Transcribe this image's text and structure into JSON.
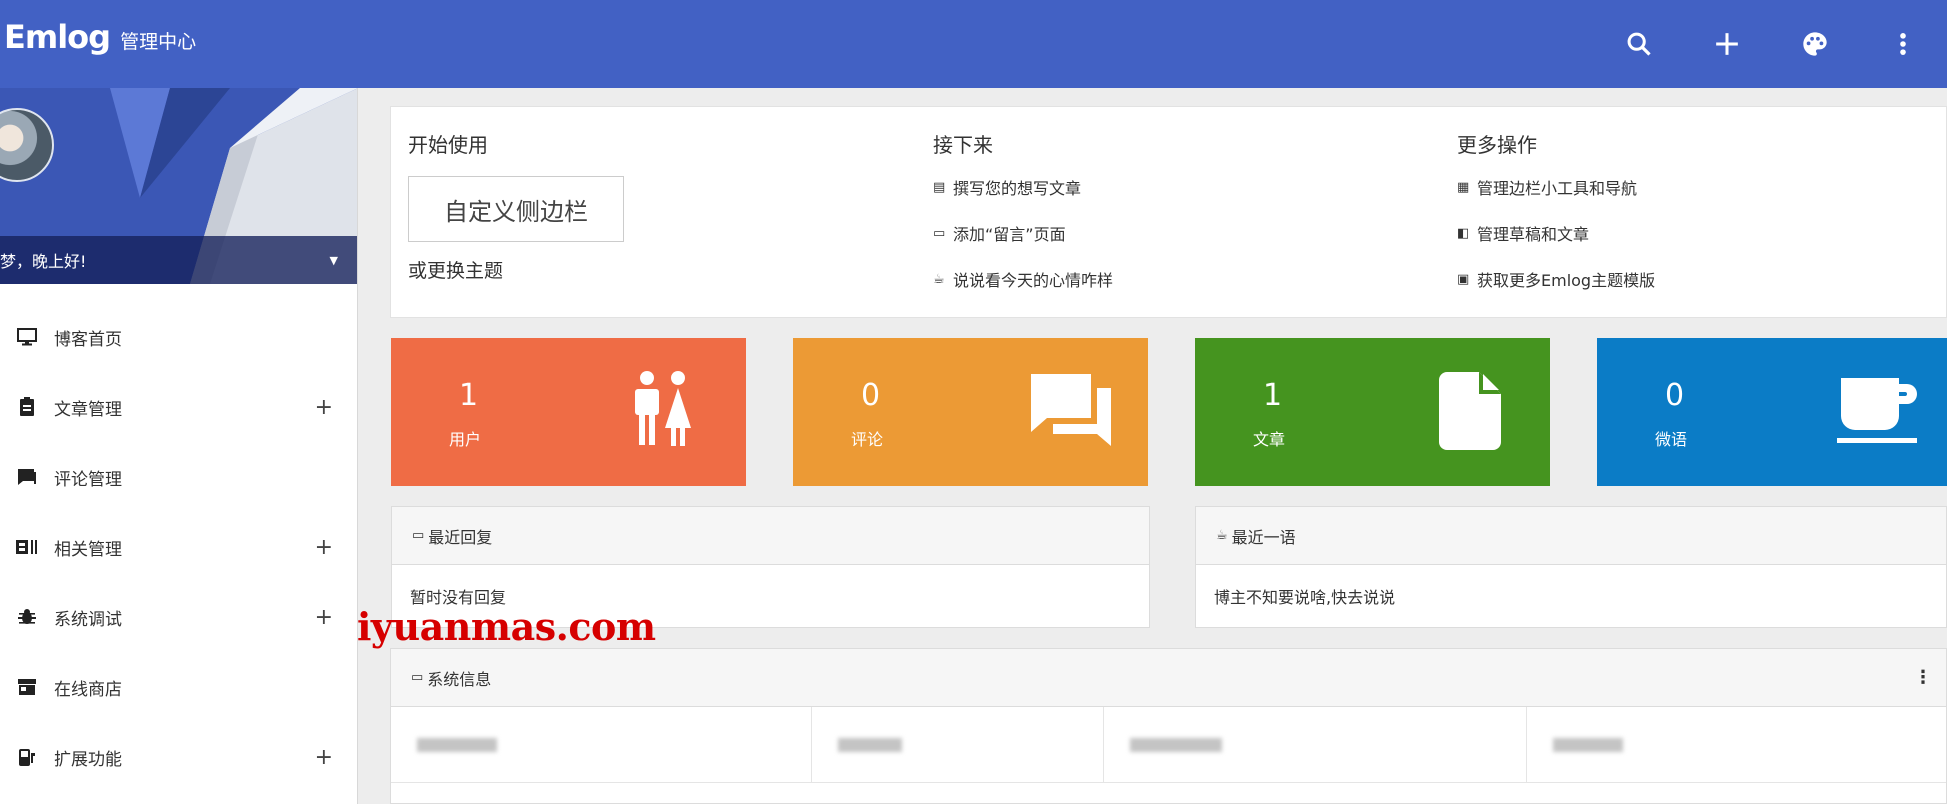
{
  "topbar": {
    "logo": "Emlog",
    "subtitle": "管理中心",
    "bg_color": "#4261c4",
    "icons": [
      "search-icon",
      "plus-icon",
      "palette-icon",
      "more-vert-icon"
    ]
  },
  "sidebar": {
    "greeting": "梦，晚上好!",
    "items": [
      {
        "label": "博客首页",
        "icon": "monitor-icon",
        "expandable": false
      },
      {
        "label": "文章管理",
        "icon": "clipboard-icon",
        "expandable": true
      },
      {
        "label": "评论管理",
        "icon": "comment-icon",
        "expandable": false
      },
      {
        "label": "相关管理",
        "icon": "dashboard-icon",
        "expandable": true
      },
      {
        "label": "系统调试",
        "icon": "bug-icon",
        "expandable": true
      },
      {
        "label": "在线商店",
        "icon": "store-icon",
        "expandable": false
      },
      {
        "label": "扩展功能",
        "icon": "extension-icon",
        "expandable": true
      }
    ]
  },
  "start": {
    "col1_title": "开始使用",
    "custom_button": "自定义侧边栏",
    "alt_link": "或更换主题",
    "col2_title": "接下来",
    "col2_links": [
      "撰写您的想写文章",
      "添加“留言”页面",
      "说说看今天的心情咋样"
    ],
    "col3_title": "更多操作",
    "col3_links": [
      "管理边栏小工具和导航",
      "管理草稿和文章",
      "获取更多Emlog主题模版"
    ]
  },
  "stats": [
    {
      "value": "1",
      "label": "用户",
      "color": "#ef6c45",
      "icon": "users-icon"
    },
    {
      "value": "0",
      "label": "评论",
      "color": "#ec9a35",
      "icon": "chat-icon"
    },
    {
      "value": "1",
      "label": "文章",
      "color": "#45941f",
      "icon": "file-icon"
    },
    {
      "value": "0",
      "label": "微语",
      "color": "#0b7cc6",
      "icon": "cup-icon"
    }
  ],
  "recent_reply": {
    "title": "最近回复",
    "body": "暂时没有回复"
  },
  "recent_twitter": {
    "title": "最近一语",
    "body": "博主不知要说啥,快去说说"
  },
  "system_info": {
    "title": "系统信息",
    "menu": "⋮"
  },
  "watermark": "iyuanmas.com"
}
